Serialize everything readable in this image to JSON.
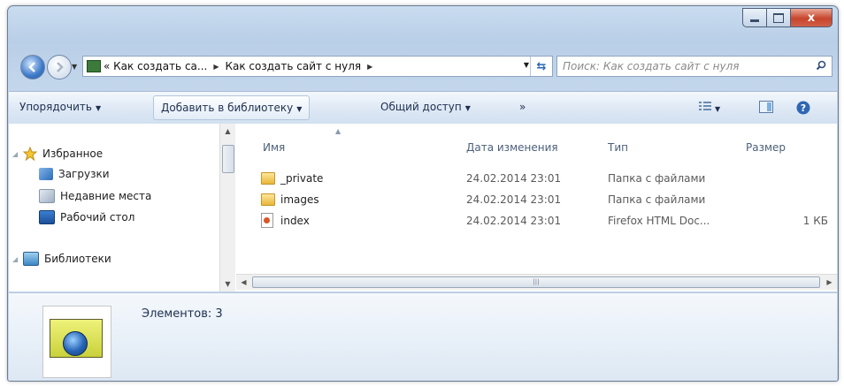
{
  "window": {
    "close_symbol": "x"
  },
  "address": {
    "crumb_1": "Как создать са...",
    "crumb_2": "Как создать сайт с нуля"
  },
  "search": {
    "placeholder": "Поиск: Как создать сайт с нуля"
  },
  "toolbar": {
    "organize": "Упорядочить",
    "add_library": "Добавить в библиотеку",
    "share": "Общий доступ",
    "more": "»"
  },
  "nav": {
    "favorites": "Избранное",
    "downloads": "Загрузки",
    "recent": "Недавние места",
    "desktop": "Рабочий стол",
    "libraries": "Библиотеки"
  },
  "columns": {
    "name": "Имя",
    "date": "Дата изменения",
    "type": "Тип",
    "size": "Размер"
  },
  "files": [
    {
      "name": "_private",
      "date": "24.02.2014 23:01",
      "type": "Папка с файлами",
      "size": ""
    },
    {
      "name": "images",
      "date": "24.02.2014 23:01",
      "type": "Папка с файлами",
      "size": ""
    },
    {
      "name": "index",
      "date": "24.02.2014 23:01",
      "type": "Firefox HTML Doc...",
      "size": "1 КБ"
    }
  ],
  "details": {
    "count": "Элементов: 3"
  }
}
